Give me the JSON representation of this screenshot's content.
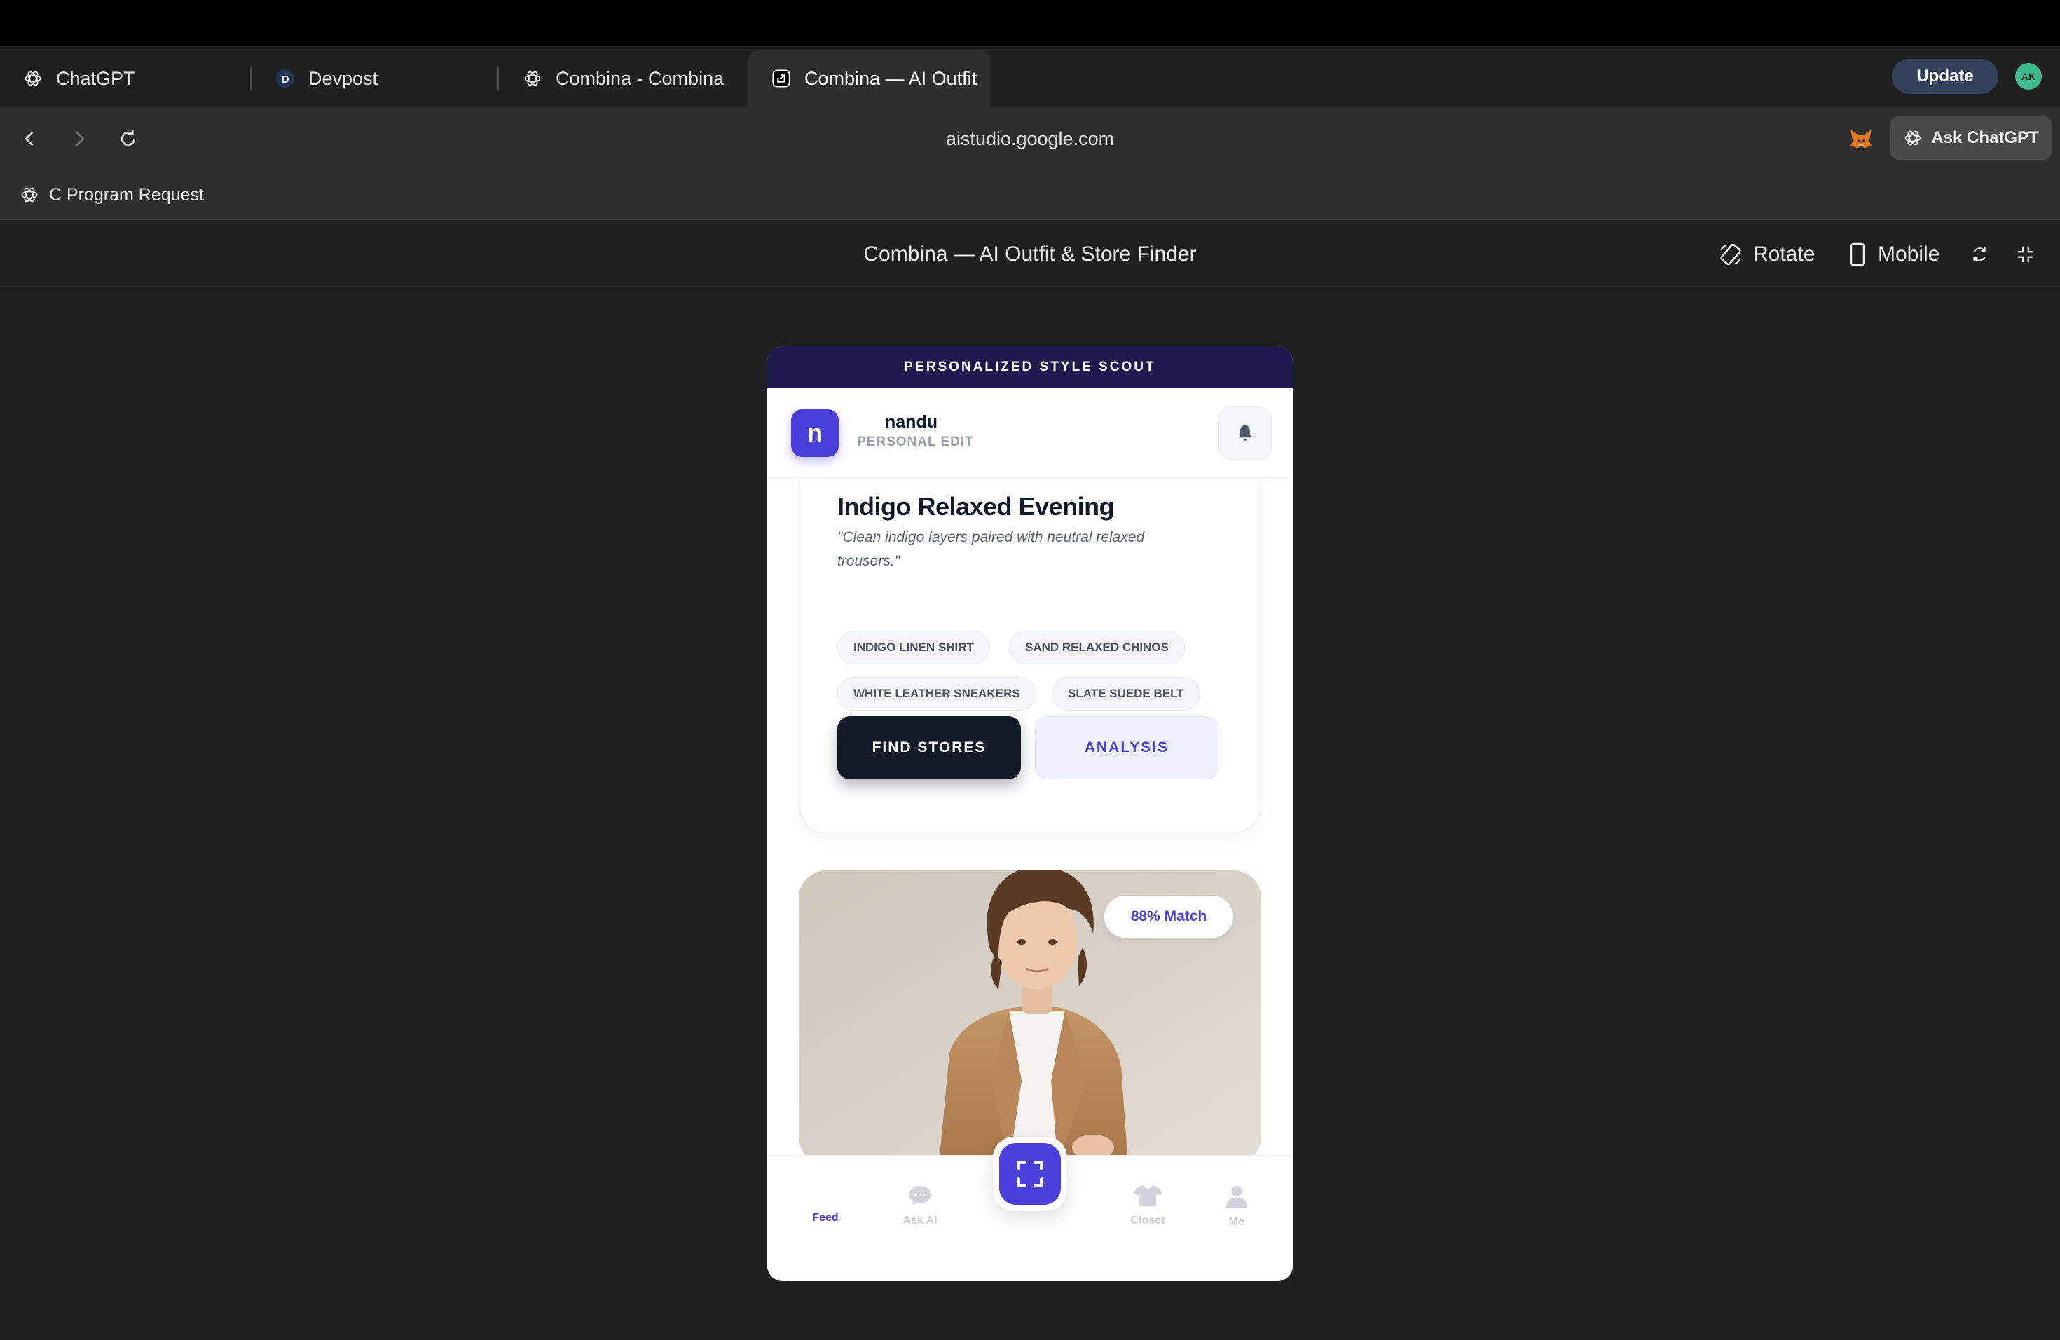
{
  "browser": {
    "tabs": [
      {
        "title": "ChatGPT"
      },
      {
        "title": "Devpost"
      },
      {
        "title": "Combina - Combina"
      },
      {
        "title": "Combina — AI Outfit"
      }
    ],
    "update_label": "Update",
    "profile_initials": "AK",
    "url": "aistudio.google.com",
    "ask_label": "Ask ChatGPT",
    "bookmark": "C Program Request"
  },
  "studio": {
    "title": "Combina — AI Outfit & Store Finder",
    "rotate_label": "Rotate",
    "mobile_label": "Mobile"
  },
  "app": {
    "banner": "PERSONALIZED STYLE SCOUT",
    "user": {
      "initial": "n",
      "name": "nandu",
      "subtitle": "PERSONAL EDIT"
    },
    "outfit": {
      "title": "Indigo Relaxed Evening",
      "quote": "\"Clean indigo layers paired with neutral relaxed trousers.\"",
      "items": [
        "INDIGO LINEN SHIRT",
        "SAND RELAXED CHINOS",
        "WHITE LEATHER SNEAKERS",
        "SLATE SUEDE BELT"
      ],
      "find_label": "FIND STORES",
      "analysis_label": "ANALYSIS"
    },
    "photo": {
      "match": "88% Match"
    },
    "nav": {
      "feed": "Feed",
      "ask": "Ask AI",
      "closet": "Closet",
      "me": "Me"
    }
  },
  "colors": {
    "accent": "#4b3fdb",
    "banner": "#1e1a4d",
    "dark_button": "#111827"
  }
}
